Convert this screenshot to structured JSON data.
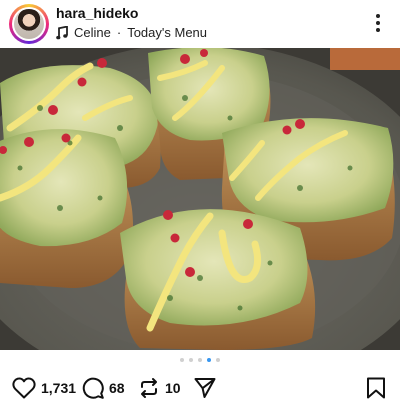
{
  "post": {
    "username": "hara_hideko",
    "music": {
      "artist": "Celine",
      "separator": "·",
      "title": "Today's Menu"
    }
  },
  "carousel": {
    "total": 5,
    "active": 3
  },
  "actions": {
    "likes": "1,731",
    "comments": "68",
    "reposts": "10"
  },
  "icons": {
    "music": "music-note-icon",
    "more": "more-vertical-icon",
    "mute": "speaker-muted-icon",
    "like": "heart-icon",
    "comment": "comment-bubble-icon",
    "repost": "repost-arrows-icon",
    "share": "send-paper-plane-icon",
    "save": "bookmark-icon"
  },
  "colors": {
    "carousel_active": "#3897f0",
    "carousel_inactive": "#d0d0d0",
    "text": "#111111"
  }
}
